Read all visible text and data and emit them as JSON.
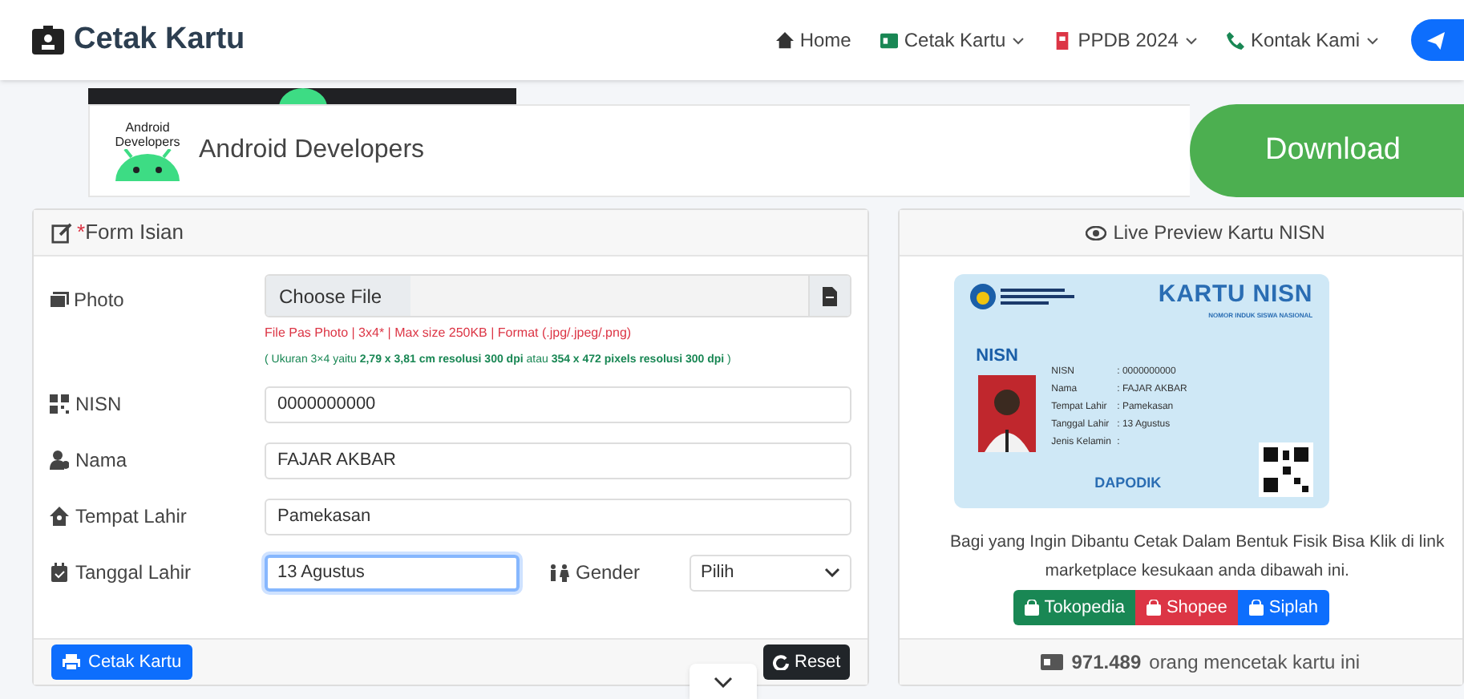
{
  "brand": "Cetak Kartu",
  "nav": [
    {
      "label": "Home",
      "dropdown": false
    },
    {
      "label": "Cetak Kartu",
      "dropdown": true
    },
    {
      "label": "PPDB 2024",
      "dropdown": true
    },
    {
      "label": "Kontak Kami",
      "dropdown": true
    }
  ],
  "ad": {
    "logo_text": "Android Developers",
    "title": "Android Developers",
    "button": "Download"
  },
  "form": {
    "required_mark": "*",
    "title": "Form Isian",
    "photo": {
      "label": "Photo",
      "button": "Choose File",
      "hint": "File Pas Photo | 3x4* | Max size 250KB | Format (.jpg/.jpeg/.png)",
      "note": "( Ukuran 3×4 yaitu **2,79 x 3,81 cm resolusi 300 dpi** atau **354 x 472 pixels resolusi 300 dpi** )"
    },
    "fields": [
      {
        "label": "NISN",
        "value": "0000000000",
        "focused": false
      },
      {
        "label": "Nama",
        "value": "FAJAR AKBAR",
        "focused": false
      },
      {
        "label": "Tempat Lahir",
        "value": "Pamekasan",
        "focused": false
      },
      {
        "label": "Tanggal Lahir",
        "value": "13 Agustus",
        "focused": true
      }
    ],
    "gender": {
      "label": "Gender",
      "value": "Pilih"
    },
    "submit": "Cetak Kartu",
    "reset": "Reset"
  },
  "preview": {
    "title": "Live Preview Kartu NISN",
    "card": {
      "heading": "KARTU NISN",
      "subheading": "NOMOR INDUK SISWA NASIONAL",
      "badge": "NISN",
      "footer_logo": "DAPODIK",
      "rows": [
        {
          "label": "NISN",
          "value": ": 0000000000"
        },
        {
          "label": "Nama",
          "value": ": FAJAR AKBAR"
        },
        {
          "label": "Tempat Lahir",
          "value": ": Pamekasan"
        },
        {
          "label": "Tanggal Lahir",
          "value": ": 13 Agustus"
        },
        {
          "label": "Jenis Kelamin",
          "value": ":"
        }
      ]
    },
    "message": "Bagi yang Ingin Dibantu Cetak Dalam Bentuk Fisik Bisa Klik di link marketplace kesukaan anda dibawah ini.",
    "shops": [
      {
        "label": "Tokopedia",
        "color": "#198754"
      },
      {
        "label": "Shopee",
        "color": "#dc3545"
      },
      {
        "label": "Siplah",
        "color": "#0d6efd"
      }
    ],
    "count": "971.489",
    "count_text": "orang mencetak kartu ini"
  }
}
